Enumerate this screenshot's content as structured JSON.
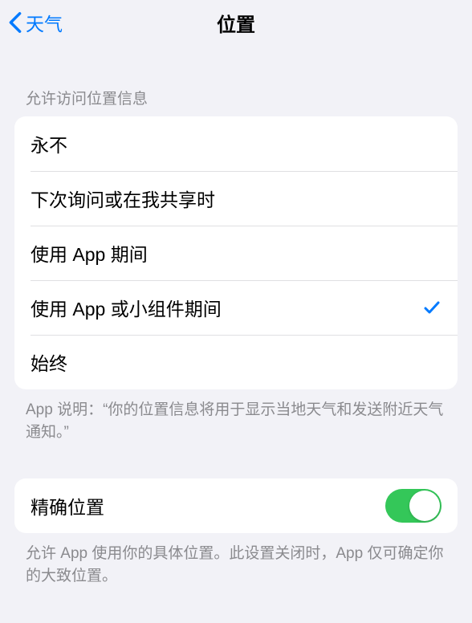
{
  "nav": {
    "back_label": "天气",
    "title": "位置"
  },
  "section1": {
    "header": "允许访问位置信息",
    "options": [
      {
        "label": "永不",
        "selected": false
      },
      {
        "label": "下次询问或在我共享时",
        "selected": false
      },
      {
        "label": "使用 App 期间",
        "selected": false
      },
      {
        "label": "使用 App 或小组件期间",
        "selected": true
      },
      {
        "label": "始终",
        "selected": false
      }
    ],
    "footer": "App 说明：“你的位置信息将用于显示当地天气和发送附近天气通知。”"
  },
  "section2": {
    "precise_label": "精确位置",
    "precise_on": true,
    "footer": "允许 App 使用你的具体位置。此设置关闭时，App 仅可确定你的大致位置。"
  },
  "colors": {
    "accent": "#007aff",
    "toggle_on": "#34c759",
    "background": "#f2f2f7"
  }
}
